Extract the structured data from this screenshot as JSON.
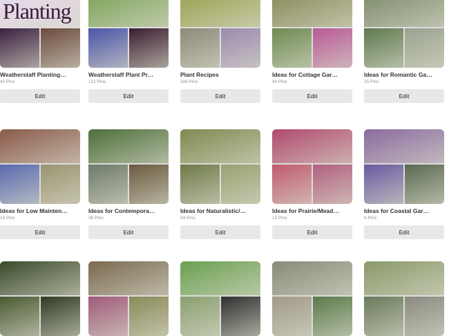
{
  "boards": [
    {
      "title": "Weatherstaff Planting…",
      "pins": "42 Pins",
      "edit": "Edit",
      "colors": {
        "big": "#e6d9ec",
        "sm1": "#3b2140",
        "sm2": "#6b4a3e"
      },
      "logo": "Planting"
    },
    {
      "title": "Weatherstaff Plant Pr…",
      "pins": "121 Pins",
      "edit": "Edit",
      "colors": {
        "big": "#7ea45a",
        "sm1": "#4b55a8",
        "sm2": "#3a1e30"
      }
    },
    {
      "title": "Plant Recipes",
      "pins": "106 Pins",
      "edit": "Edit",
      "colors": {
        "big": "#9aa250",
        "sm1": "#8c8a7a",
        "sm2": "#9b8ab0"
      }
    },
    {
      "title": "Ideas for Cottage Gar…",
      "pins": "44 Pins",
      "edit": "Edit",
      "colors": {
        "big": "#8a8a5a",
        "sm1": "#6e8a50",
        "sm2": "#b85a96"
      }
    },
    {
      "title": "Ideas for Romantic Ga…",
      "pins": "25 Pins",
      "edit": "Edit",
      "colors": {
        "big": "#7e8c6c",
        "sm1": "#5f7a4f",
        "sm2": "#9aa290"
      }
    },
    {
      "title": "Ideas for Low Mainten…",
      "pins": "15 Pins",
      "edit": "Edit",
      "colors": {
        "big": "#8a5a4a",
        "sm1": "#5a6ab0",
        "sm2": "#9a9470"
      }
    },
    {
      "title": "Ideas for Contempora…",
      "pins": "36 Pins",
      "edit": "Edit",
      "colors": {
        "big": "#4d6e3a",
        "sm1": "#6e7a6a",
        "sm2": "#6a5a3e"
      }
    },
    {
      "title": "Ideas for Naturalistic/…",
      "pins": "24 Pins",
      "edit": "Edit",
      "colors": {
        "big": "#7e8a50",
        "sm1": "#6e7a48",
        "sm2": "#9aa070"
      }
    },
    {
      "title": "Ideas for Prairie/Mead…",
      "pins": "12 Pins",
      "edit": "Edit",
      "colors": {
        "big": "#b04a6e",
        "sm1": "#c05a6e",
        "sm2": "#b26080"
      }
    },
    {
      "title": "Ideas for Coastal Gar…",
      "pins": "6 Pins",
      "edit": "Edit",
      "colors": {
        "big": "#8a6aa0",
        "sm1": "#6a5aa0",
        "sm2": "#5a6a50"
      }
    },
    {
      "title": "",
      "pins": "",
      "edit": "",
      "colors": {
        "big": "#3a4a2a",
        "sm1": "#4a5a32",
        "sm2": "#2e3a22"
      }
    },
    {
      "title": "",
      "pins": "",
      "edit": "",
      "colors": {
        "big": "#7a6a50",
        "sm1": "#a05a7a",
        "sm2": "#8a8a5a"
      }
    },
    {
      "title": "",
      "pins": "",
      "edit": "",
      "colors": {
        "big": "#6aa050",
        "sm1": "#8aa070",
        "sm2": "#303030"
      }
    },
    {
      "title": "",
      "pins": "",
      "edit": "",
      "colors": {
        "big": "#8a8a7a",
        "sm1": "#a09a8a",
        "sm2": "#5a7a4a"
      }
    },
    {
      "title": "",
      "pins": "",
      "edit": "",
      "colors": {
        "big": "#8a9a6a",
        "sm1": "#6a7a5a",
        "sm2": "#8a8a80"
      }
    }
  ]
}
